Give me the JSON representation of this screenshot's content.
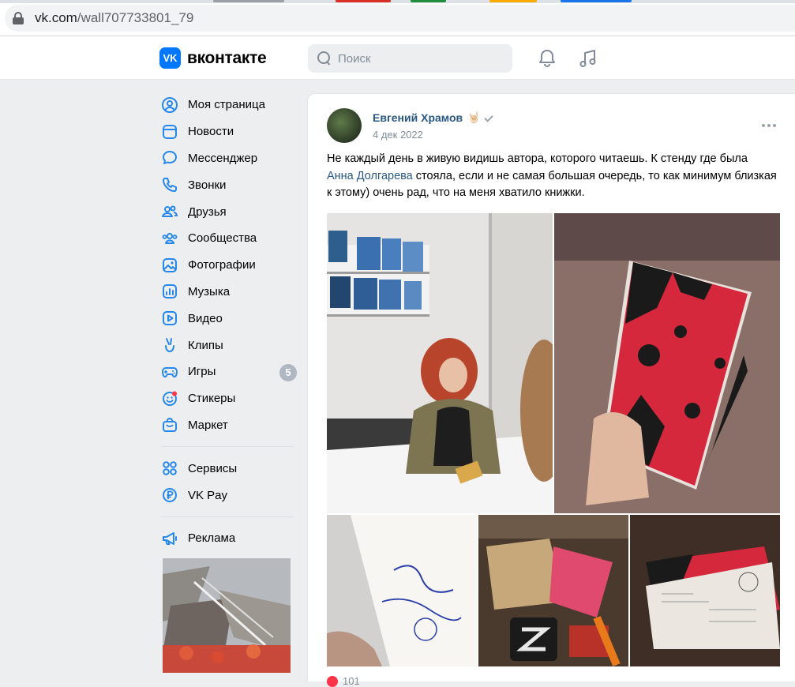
{
  "browser": {
    "url_domain": "vk.com",
    "url_path": "/wall707733801_79"
  },
  "header": {
    "logo_mark": "VK",
    "logo_text": "вконтакте",
    "search_placeholder": "Поиск"
  },
  "sidebar": {
    "items": [
      {
        "label": "Моя страница",
        "icon": "user-circle-icon"
      },
      {
        "label": "Новости",
        "icon": "newspaper-icon"
      },
      {
        "label": "Мессенджер",
        "icon": "message-bubble-icon"
      },
      {
        "label": "Звонки",
        "icon": "phone-icon"
      },
      {
        "label": "Друзья",
        "icon": "friends-icon"
      },
      {
        "label": "Сообщества",
        "icon": "groups-icon"
      },
      {
        "label": "Фотографии",
        "icon": "photo-icon"
      },
      {
        "label": "Музыка",
        "icon": "music-bars-icon"
      },
      {
        "label": "Видео",
        "icon": "video-play-icon"
      },
      {
        "label": "Клипы",
        "icon": "clips-icon"
      },
      {
        "label": "Игры",
        "icon": "gamepad-icon",
        "badge": "5"
      },
      {
        "label": "Стикеры",
        "icon": "sticker-smile-icon"
      },
      {
        "label": "Маркет",
        "icon": "shopping-bag-icon"
      }
    ],
    "secondary": [
      {
        "label": "Сервисы",
        "icon": "grid-services-icon"
      },
      {
        "label": "VK Pay",
        "icon": "ruble-coin-icon"
      }
    ],
    "tertiary": [
      {
        "label": "Реклама",
        "icon": "megaphone-icon"
      }
    ]
  },
  "post": {
    "author": "Евгений Храмов",
    "author_emoji": "🤘🏻",
    "date": "4 дек 2022",
    "text_part1": "Не каждый день в живую видишь автора, которого читаешь. К стенду где была ",
    "mention": "Анна Долгарева",
    "text_part2": " стояла, если и не самая большая очередь, то как минимум близкая к этому) очень рад, что на меня хватило книжки.",
    "likes": "101"
  },
  "colors": {
    "accent": "#0077ff",
    "link": "#2a5885",
    "badge": "#aeb7c2",
    "icon": "#2688eb",
    "like": "#ff3347"
  }
}
